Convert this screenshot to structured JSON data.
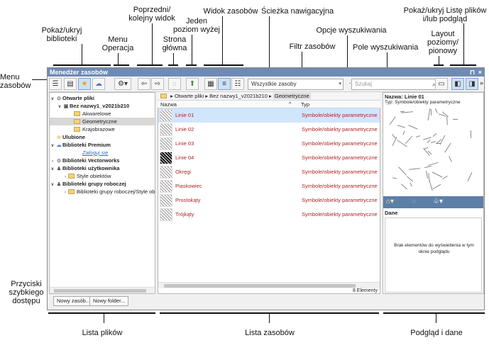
{
  "annotations": {
    "menu_zasobow": "Menu\nzasobów",
    "pokaz_ukryj_biblioteki": "Pokaż/ukryj\nbiblioteki",
    "menu_operacja": "Menu\nOperacja",
    "poprzedni_kolejny": "Poprzedni/\nkolejny widok",
    "strona_glowna": "Strona\ngłówna",
    "poziom_wyzej": "Jeden\npoziom wyżej",
    "widok_zasobow": "Widok zasobów",
    "sciezka": "Ścieżka nawigacyjna",
    "opcje_wyszukiwania": "Opcje wyszukiwania",
    "filtr_zasobow": "Filtr zasobów",
    "pole_wyszukiwania": "Pole wyszukiwania",
    "pokaz_liste": "Pokaż/ukryj Listę plików\ni/lub podgląd",
    "layout": "Layout\npoziomy/\npionowy",
    "przyciski": "Przyciski\nszybkiego\ndostępu",
    "lista_plikow": "Lista plików",
    "lista_zasobow": "Lista zasobów",
    "podglad_dane": "Podgląd i dane"
  },
  "window": {
    "title": "Menedżer zasobów",
    "pin": "⊓",
    "close": "×",
    "more": "»"
  },
  "toolbar": {
    "filter_value": "Wszystkie zasoby",
    "search_placeholder": "Szukaj"
  },
  "tree": {
    "open_files": "Otwarte pliki",
    "doc_name": "Bez nazwy1_v2021b210",
    "folders": [
      "Akwarelowe",
      "Geometryczne",
      "Krajobrazowe"
    ],
    "favorites": "Ulubione",
    "premium": "Biblioteki Premium",
    "login": "Zaloguj się",
    "vectorworks": "Biblioteki Vectorworks",
    "user_libs": "Biblioteki użytkownika",
    "user_folder": "Style obiektów",
    "workgroup": "Biblioteki grupy roboczej",
    "workgroup_folder": "Biblioteki grupy roboczej/Style ob"
  },
  "breadcrumb": [
    "Otwarte pliki",
    "Bez nazwy1_v2021b210",
    "Geometryczne"
  ],
  "list": {
    "col_name": "Nazwa",
    "col_type": "Typ",
    "rows": [
      {
        "name": "Linie 01",
        "type": "Symbole/obiekty parametryczne"
      },
      {
        "name": "Linie 02",
        "type": "Symbole/obiekty parametryczne"
      },
      {
        "name": "Linie 03",
        "type": "Symbole/obiekty parametryczne"
      },
      {
        "name": "Linie 04",
        "type": "Symbole/obiekty parametryczne"
      },
      {
        "name": "Okręgi",
        "type": "Symbole/obiekty parametryczne"
      },
      {
        "name": "Piaskowiec",
        "type": "Symbole/obiekty parametryczne"
      },
      {
        "name": "Prostokąty",
        "type": "Symbole/obiekty parametryczne"
      },
      {
        "name": "Trójkąty",
        "type": "Symbole/obiekty parametryczne"
      }
    ],
    "count": "8 Elementy"
  },
  "preview": {
    "name": "Nazwa: Linie 01",
    "type": "Typ: Symbole/obiekty parametryczne",
    "data_label": "Dane",
    "empty_msg": "Brak elementów do wyświetlenia w tym oknie podglądu"
  },
  "quick_buttons": {
    "new_resource": "Nowy zasób...",
    "new_folder": "Nowy folder..."
  }
}
